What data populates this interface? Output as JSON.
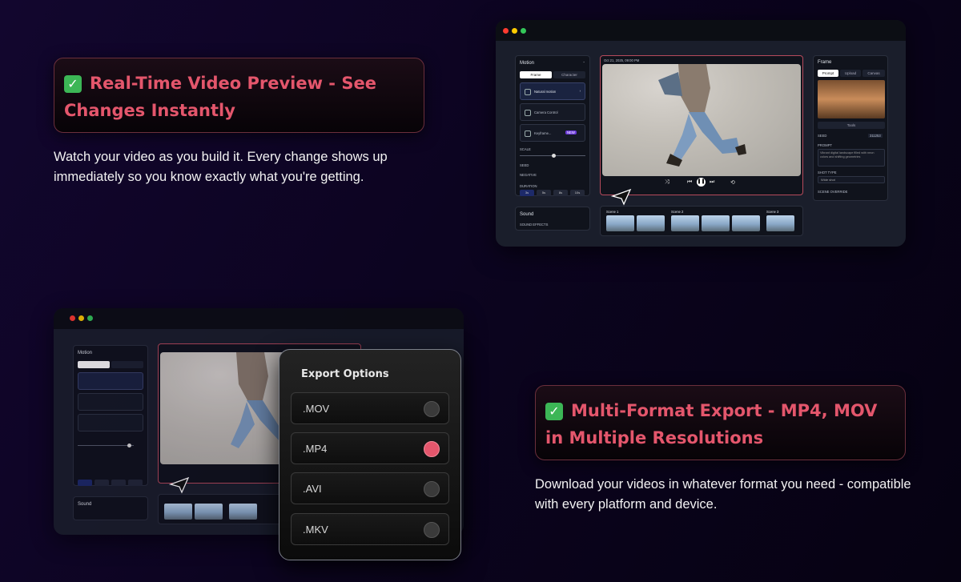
{
  "feature1": {
    "check": "✓",
    "title": "Real-Time Video Preview - See Changes Instantly",
    "description": "Watch your video as you build it. Every change shows up immediately so you know exactly what you're getting."
  },
  "feature2": {
    "check": "✓",
    "title": "Multi-Format Export - MP4, MOV in Multiple Resolutions",
    "description": "Download your videos in whatever format you need - compatible with every platform and device."
  },
  "editor": {
    "left_panel": {
      "title": "Motion",
      "tabs": [
        "Frame",
        "Character"
      ],
      "options": [
        "Natural motion",
        "Camera Control",
        "Keyframe...",
        "NEW"
      ],
      "scale_label": "SCALE",
      "seed_label": "SEED",
      "negative_label": "NEGATIVE",
      "duration_label": "DURATION",
      "durations": [
        "3s",
        "5s",
        "8s",
        "10s"
      ],
      "sound_title": "Sound",
      "sound_effects": "SOUND EFFECTS"
    },
    "preview_timestamp": "Oct 21, 2025, 09:00 PM",
    "scenes": [
      "Scene 1",
      "Scene 2",
      "Scene 3"
    ],
    "right_panel": {
      "title": "Frame",
      "tabs": [
        "Prompt",
        "Upload",
        "Canvas"
      ],
      "tools": "Tools",
      "seed_label": "SEED",
      "seed_value": "311253",
      "prompt_label": "PROMPT",
      "prompt_text": "Vibrant digital landscape filled with neon colors and shifting geometries",
      "shot_type_label": "SHOT TYPE",
      "shot_type_value": "Wide shot",
      "scene_override": "SCENE OVERRIDE"
    }
  },
  "export": {
    "title": "Export Options",
    "formats": [
      {
        "label": ".MOV",
        "selected": false
      },
      {
        "label": ".MP4",
        "selected": true
      },
      {
        "label": ".AVI",
        "selected": false
      },
      {
        "label": ".MKV",
        "selected": false
      }
    ]
  },
  "colors": {
    "accent": "#e4566c",
    "check": "#3cb656",
    "background": "#0c0420"
  }
}
